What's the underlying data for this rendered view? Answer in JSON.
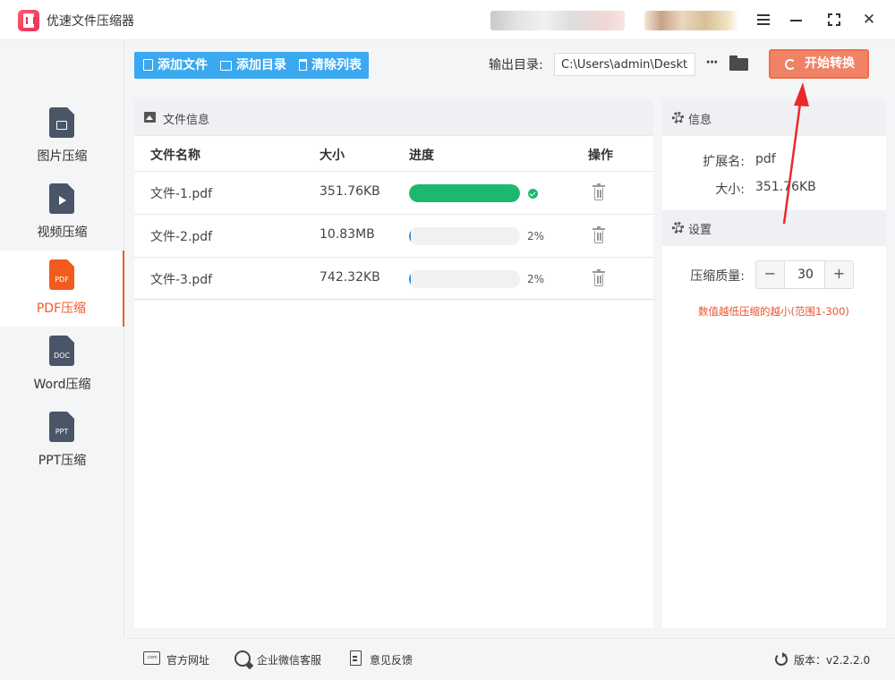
{
  "app": {
    "title": "优速文件压缩器"
  },
  "sidebar": {
    "items": [
      {
        "label": "图片压缩",
        "icon": "image-file-icon",
        "badge": "",
        "active": false
      },
      {
        "label": "视频压缩",
        "icon": "video-file-icon",
        "badge": "",
        "active": false
      },
      {
        "label": "PDF压缩",
        "icon": "pdf-file-icon",
        "badge": "PDF",
        "active": true
      },
      {
        "label": "Word压缩",
        "icon": "doc-file-icon",
        "badge": "DOC",
        "active": false
      },
      {
        "label": "PPT压缩",
        "icon": "ppt-file-icon",
        "badge": "PPT",
        "active": false
      }
    ]
  },
  "toolbar": {
    "add_file": "添加文件",
    "add_folder": "添加目录",
    "clear_list": "清除列表",
    "output_label": "输出目录:",
    "output_path": "C:\\Users\\admin\\Desktop",
    "more": "···",
    "start": "开始转换",
    "accent": "#3aa9f0",
    "start_color": "#f08366"
  },
  "files": {
    "panel_title": "文件信息",
    "columns": [
      "文件名称",
      "大小",
      "进度",
      "操作"
    ],
    "rows": [
      {
        "name": "文件-1.pdf",
        "size": "351.76KB",
        "progress": 100,
        "progress_text": "",
        "done": true
      },
      {
        "name": "文件-2.pdf",
        "size": "10.83MB",
        "progress": 2,
        "progress_text": "2%",
        "done": false
      },
      {
        "name": "文件-3.pdf",
        "size": "742.32KB",
        "progress": 2,
        "progress_text": "2%",
        "done": false
      }
    ],
    "done_color": "#1db86d"
  },
  "info": {
    "title": "信息",
    "ext_label": "扩展名:",
    "ext_value": "pdf",
    "size_label": "大小:",
    "size_value": "351.76KB"
  },
  "settings": {
    "title": "设置",
    "quality_label": "压缩质量:",
    "quality_value": "30",
    "minus": "−",
    "plus": "+",
    "hint": "数值越低压缩的越小(范围1-300)",
    "hint_color": "#e8542d"
  },
  "footer": {
    "website": "官方网址",
    "web_icon_text": ".com",
    "wechat": "企业微信客服",
    "feedback": "意见反馈",
    "version": "版本：v2.2.2.0"
  }
}
